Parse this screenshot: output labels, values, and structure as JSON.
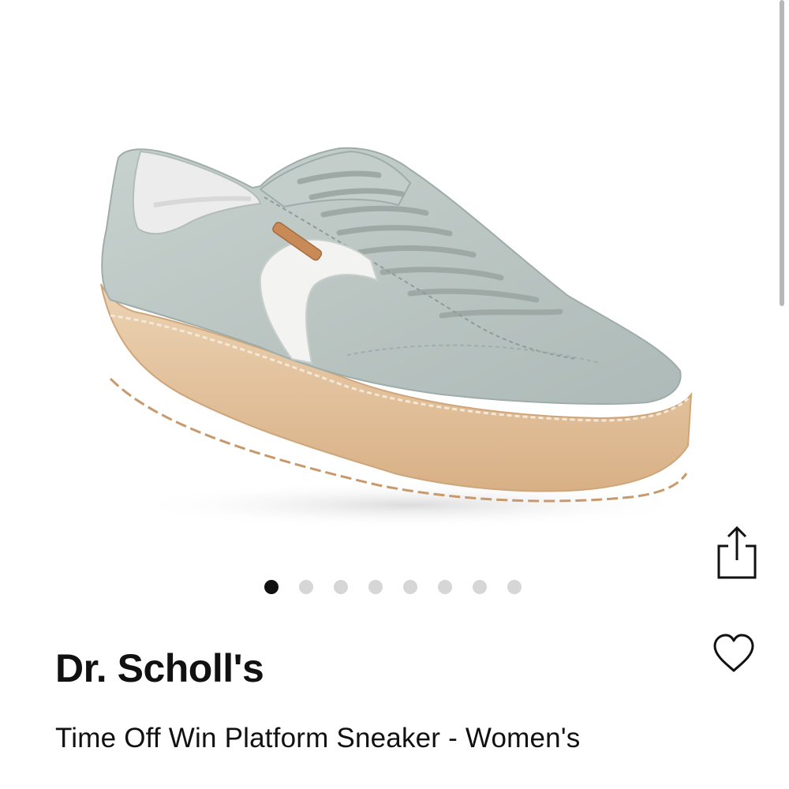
{
  "product": {
    "brand": "Dr. Scholl's",
    "name": "Time Off Win Platform Sneaker - Women's",
    "image_alt": "gray suede platform sneaker with gum sole"
  },
  "gallery": {
    "total_images": 8,
    "active_index": 0
  },
  "actions": {
    "share_icon": "share-icon",
    "favorite_icon": "heart-icon"
  },
  "colors": {
    "dot_active": "#111111",
    "dot_inactive": "#d6d6d6",
    "suede": "#b9c4c1",
    "sole": "#e3c39e"
  }
}
